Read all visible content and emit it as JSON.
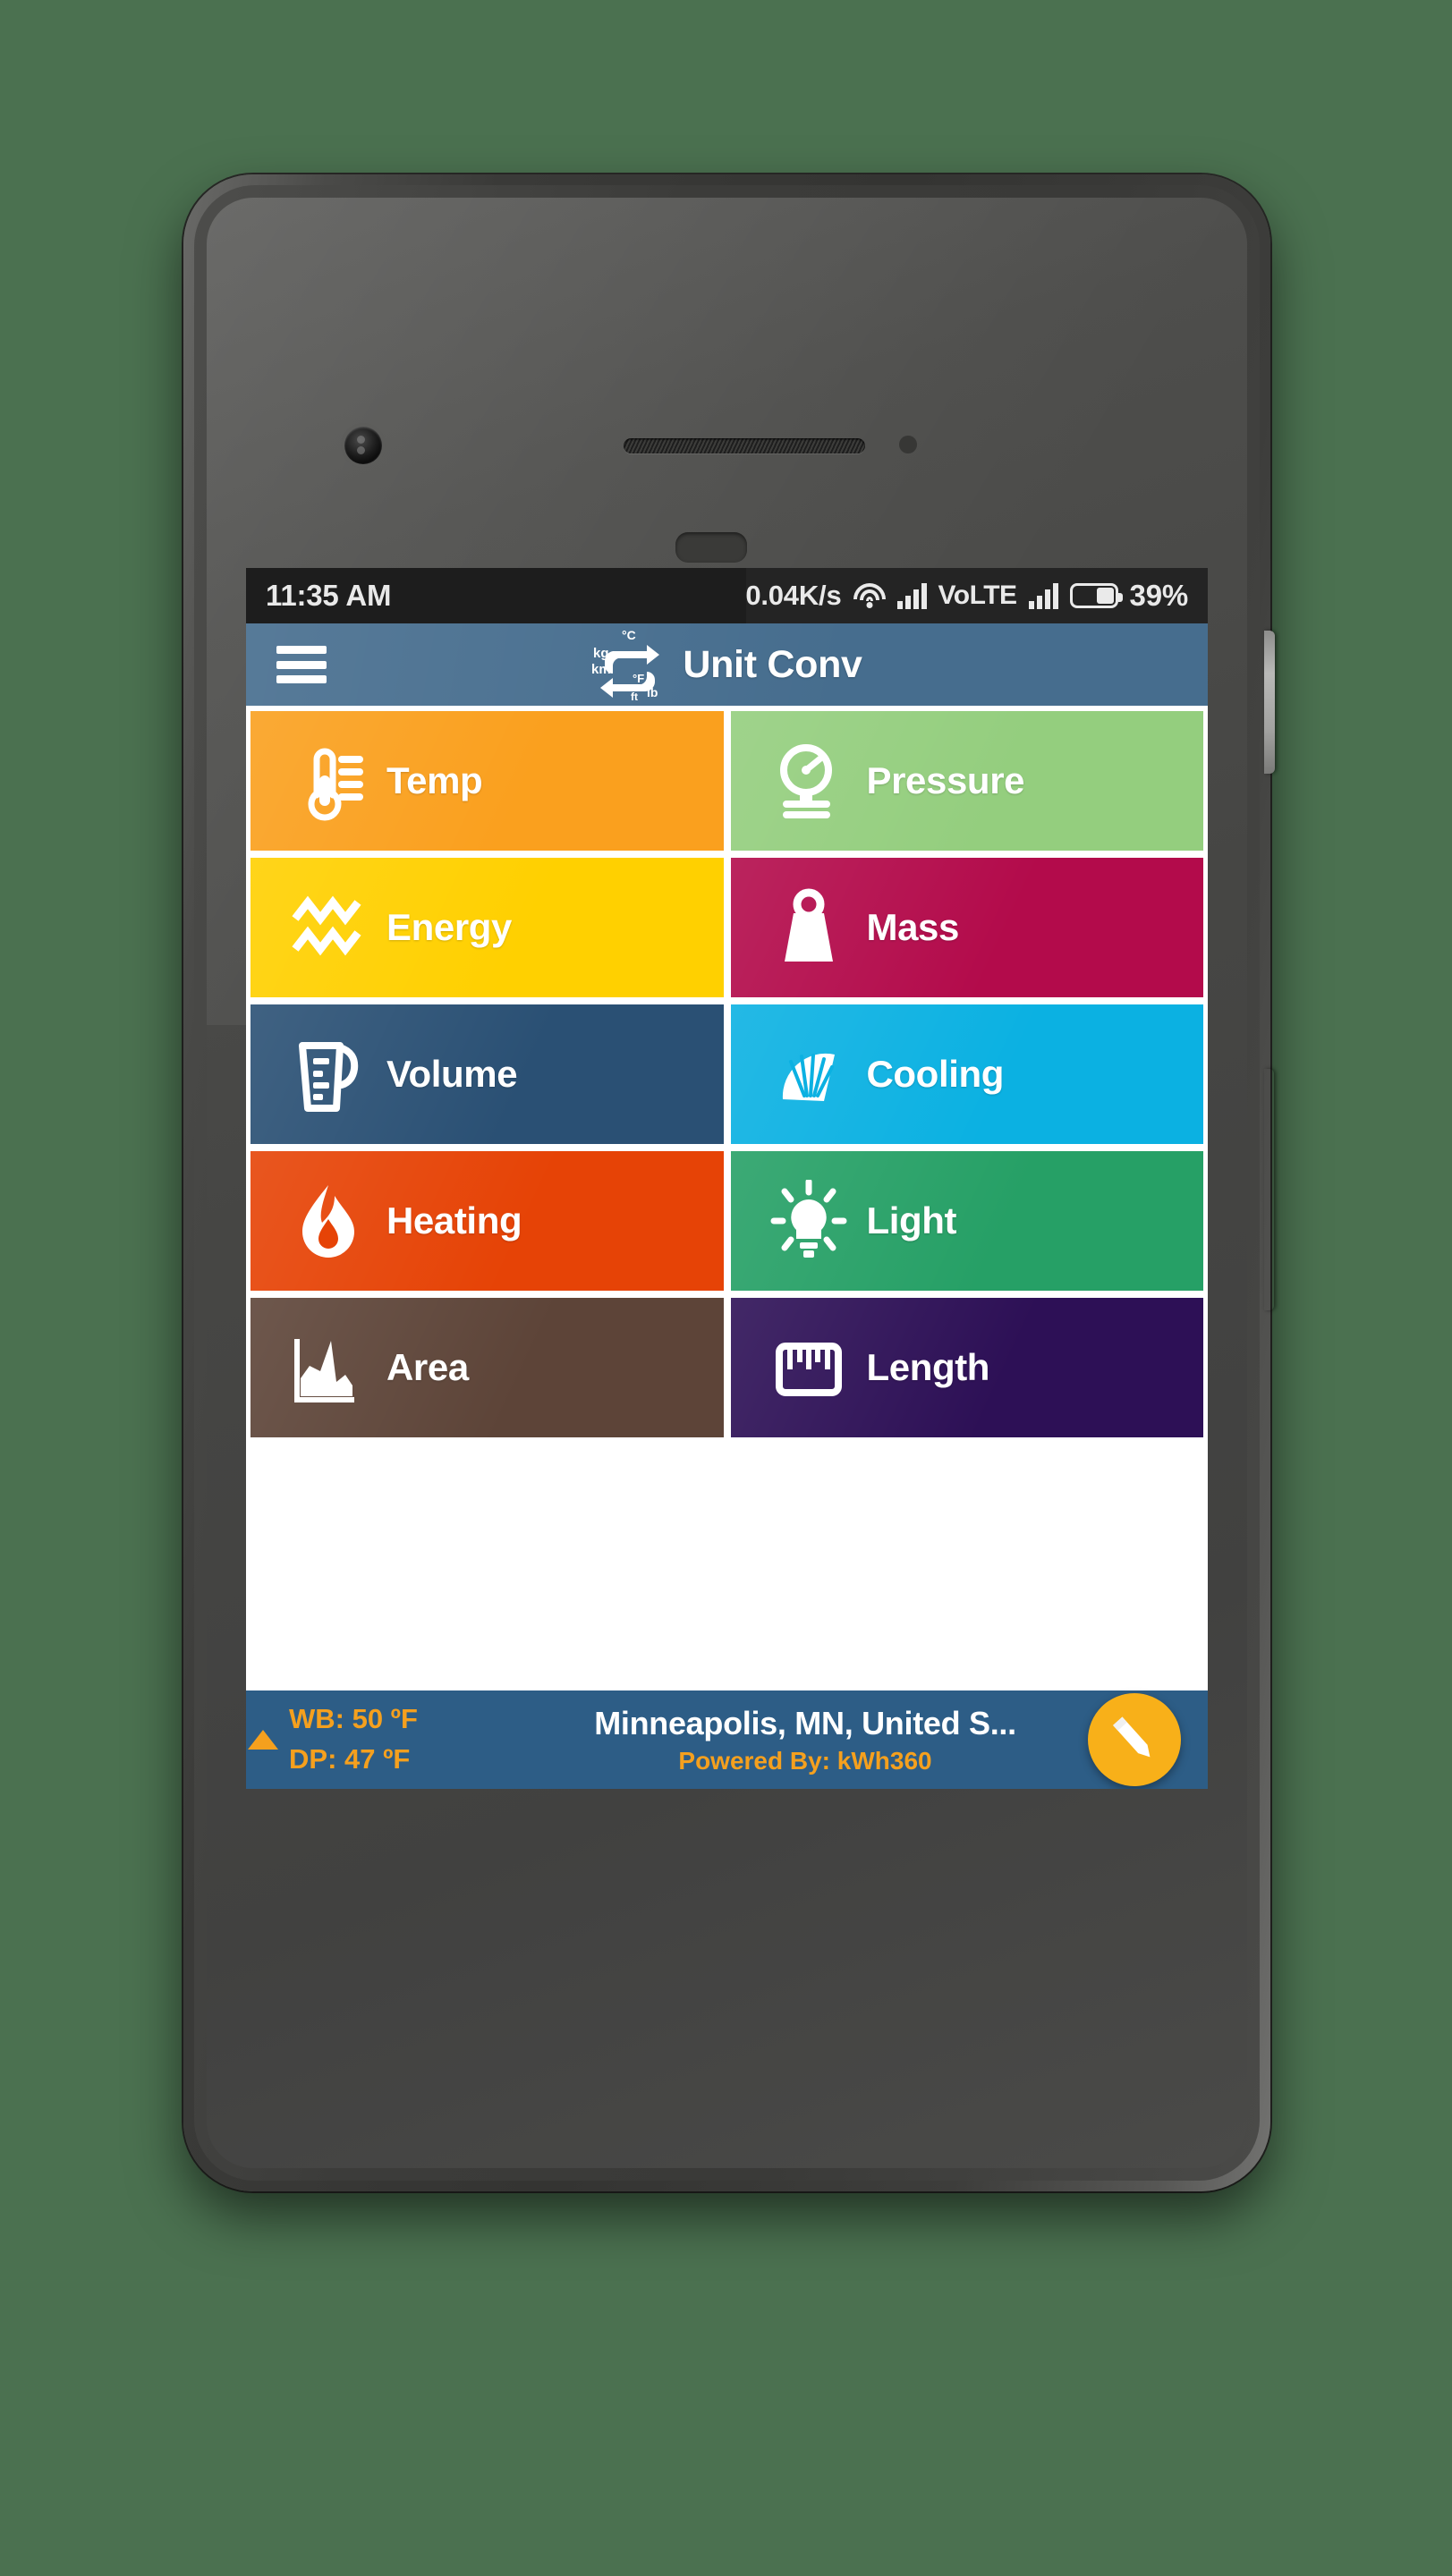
{
  "background_color": "#4b7150",
  "device": {
    "name": "android-phone",
    "front_camera_icon": "camera-icon",
    "earpiece_icon": "speaker-icon",
    "power_button": "power-button",
    "volume_button": "volume-rocker"
  },
  "status_bar": {
    "time": "11:35 AM",
    "network_speed": "0.04K/s",
    "wifi_icon": "wifi-icon",
    "signal_icon_1": "signal-bars-icon",
    "volte": "VoLTE",
    "signal_icon_2": "signal-bars-icon",
    "battery_icon": "battery-icon",
    "battery_percent": "39%"
  },
  "app_bar": {
    "menu_icon": "hamburger-menu-icon",
    "logo_icon": "unit-conversion-logo-icon",
    "logo_labels": [
      "°C",
      "kg",
      "km",
      "°F",
      "lb",
      "ft"
    ],
    "title": "Unit Conv",
    "background_color": "#466d8e"
  },
  "tiles": [
    {
      "label": "Temp",
      "icon": "thermometer-icon",
      "color": "#faa01e"
    },
    {
      "label": "Pressure",
      "icon": "gauge-icon",
      "color": "#94ce7e"
    },
    {
      "label": "Energy",
      "icon": "energy-waves-icon",
      "color": "#ffd000"
    },
    {
      "label": "Mass",
      "icon": "weight-icon",
      "color": "#b30b4b"
    },
    {
      "label": "Volume",
      "icon": "measuring-cup-icon",
      "color": "#2a5074"
    },
    {
      "label": "Cooling",
      "icon": "fan-icon",
      "color": "#0bb1e2"
    },
    {
      "label": "Heating",
      "icon": "flame-icon",
      "color": "#e64306"
    },
    {
      "label": "Light",
      "icon": "lightbulb-icon",
      "color": "#26a066"
    },
    {
      "label": "Area",
      "icon": "area-chart-icon",
      "color": "#5d4438"
    },
    {
      "label": "Length",
      "icon": "ruler-icon",
      "color": "#2d1056"
    }
  ],
  "weather_bar": {
    "background_color": "#2d5d86",
    "accent_color": "#f5a01e",
    "expand_icon": "triangle-up-icon",
    "wet_bulb": "WB: 50 ºF",
    "dew_point": "DP: 47 ºF",
    "location": "Minneapolis, MN, United S...",
    "powered_by": "Powered By: kWh360",
    "fab_icon": "edit-pencil-icon"
  }
}
